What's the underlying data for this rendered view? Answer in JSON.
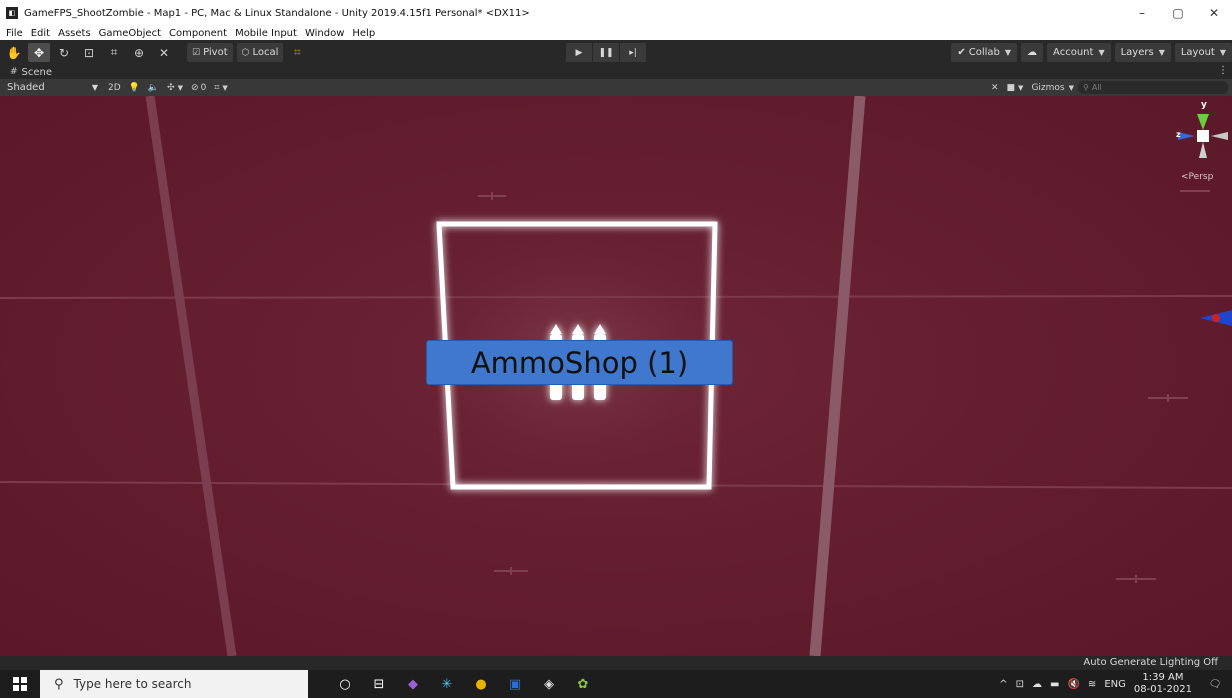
{
  "window": {
    "title": "GameFPS_ShootZombie - Map1 - PC, Mac & Linux Standalone - Unity 2019.4.15f1 Personal* <DX11>",
    "minimize_glyph": "–",
    "maximize_glyph": "▢",
    "close_glyph": "✕"
  },
  "menu": {
    "items": [
      "File",
      "Edit",
      "Assets",
      "GameObject",
      "Component",
      "Mobile Input",
      "Window",
      "Help"
    ]
  },
  "toolbar": {
    "pivot_label": "Pivot",
    "local_label": "Local",
    "collab_label": "Collab",
    "account_label": "Account",
    "layers_label": "Layers",
    "layout_label": "Layout"
  },
  "scene_tab": {
    "label": "Scene"
  },
  "scene_toolbar": {
    "shading_mode": "Shaded",
    "mode_2d": "2D",
    "hidden_count": "0",
    "gizmos_label": "Gizmos",
    "search_placeholder": "All"
  },
  "viewport": {
    "selected_object_label": "AmmoShop (1)",
    "projection_label": "Persp",
    "gizmo_axis_y": "y",
    "gizmo_axis_z": "z",
    "background_color": "#641e30",
    "label_color": "#3f78cc"
  },
  "status": {
    "lighting_text": "Auto Generate Lighting Off"
  },
  "taskbar": {
    "search_placeholder": "Type here to search",
    "language": "ENG",
    "time": "1:39 AM",
    "date": "08-01-2021"
  }
}
